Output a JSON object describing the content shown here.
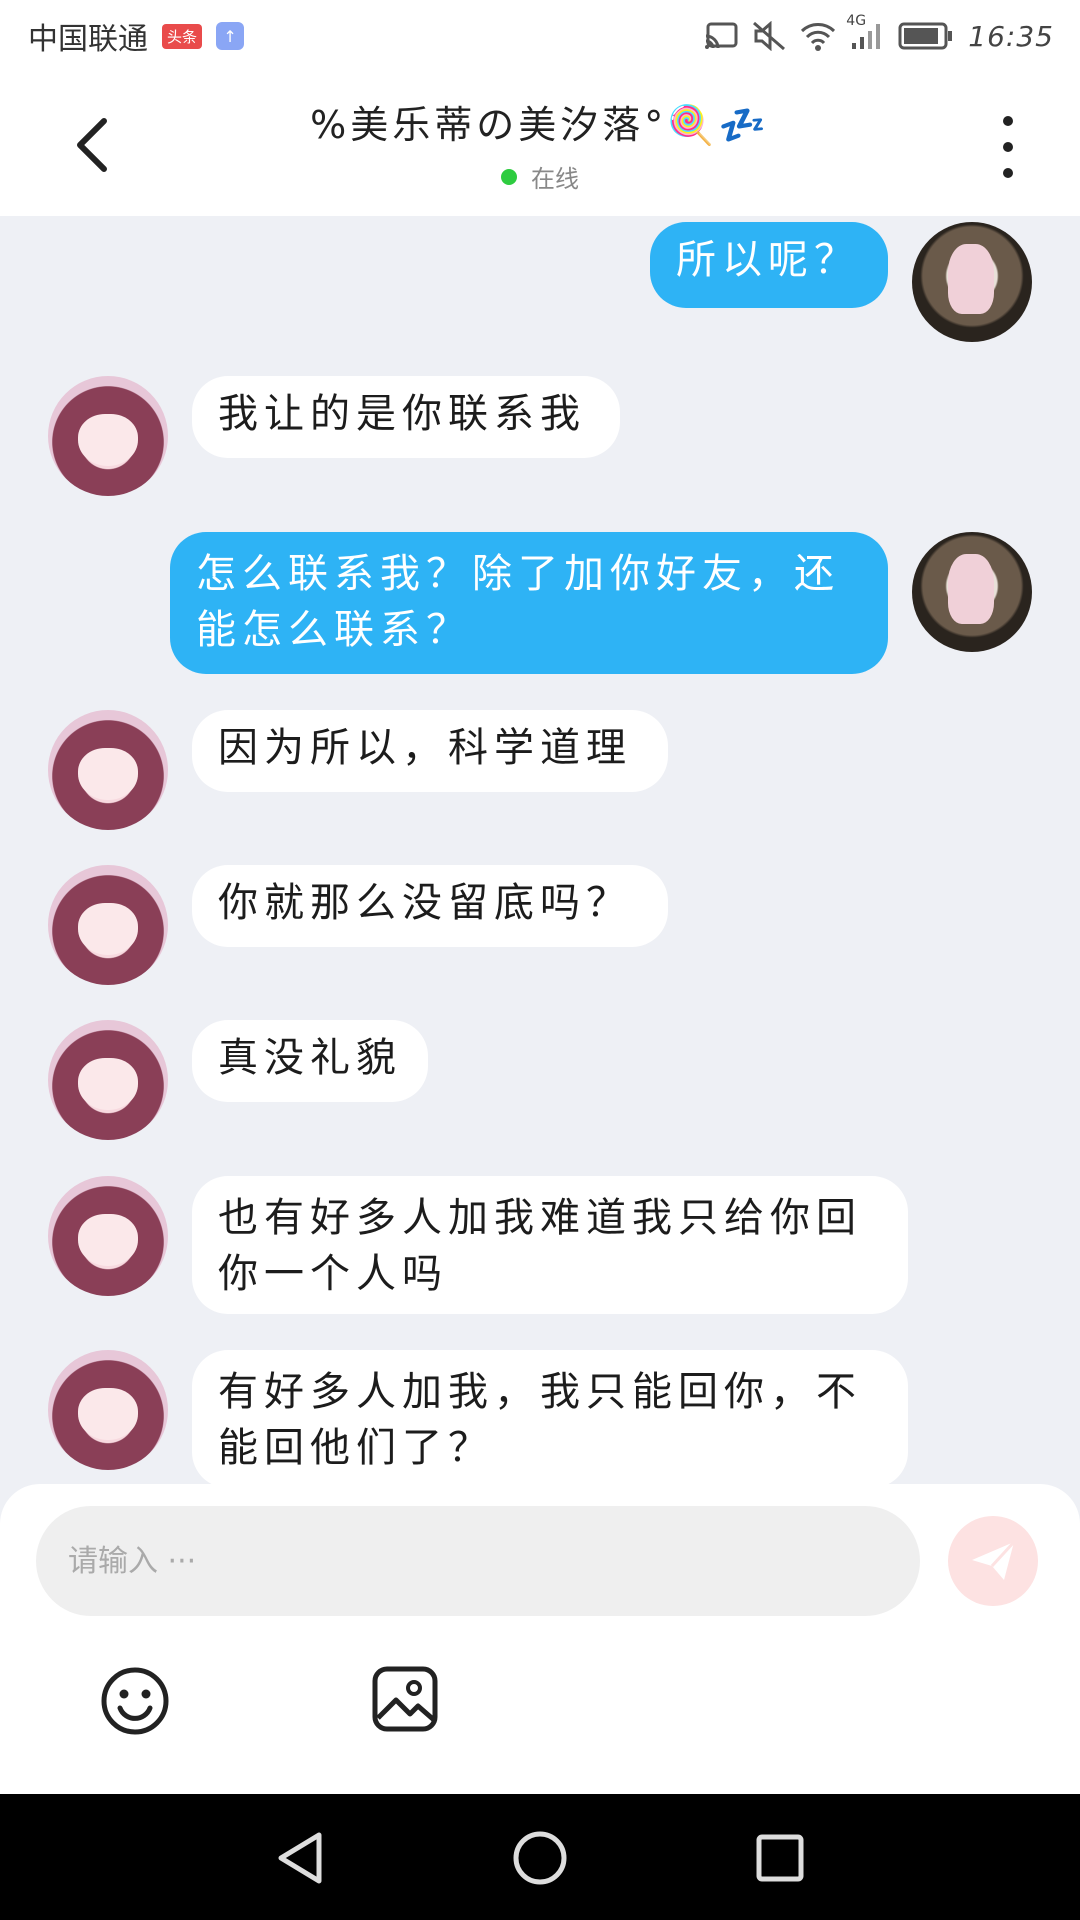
{
  "status_bar": {
    "carrier": "中国联通",
    "badge_red": "头条",
    "badge_blue": "↑",
    "network": "4G",
    "time": "16:35"
  },
  "header": {
    "title": "%美乐蒂の美汐落°🍭💤",
    "status": "在线"
  },
  "messages": [
    {
      "sender": "self",
      "text": "所以呢？"
    },
    {
      "sender": "other",
      "text": "我让的是你联系我"
    },
    {
      "sender": "self",
      "text": "怎么联系我？除了加你好友，还能怎么联系？"
    },
    {
      "sender": "other",
      "text": "因为所以，科学道理"
    },
    {
      "sender": "other",
      "text": "你就那么没留底吗？"
    },
    {
      "sender": "other",
      "text": "真没礼貌"
    },
    {
      "sender": "other",
      "text": "也有好多人加我难道我只给你回你一个人吗"
    },
    {
      "sender": "other",
      "text": "有好多人加我，我只能回你，不能回他们了？"
    }
  ],
  "input": {
    "placeholder": "请输入 ···"
  },
  "colors": {
    "self_bubble": "#2eb3f5",
    "other_bubble": "#ffffff",
    "online": "#2ecc40",
    "send_button": "#fde2e2"
  },
  "icons": {
    "back": "chevron-left-icon",
    "more": "more-vertical-icon",
    "send": "send-icon",
    "emoji": "emoji-icon",
    "image": "image-icon"
  }
}
